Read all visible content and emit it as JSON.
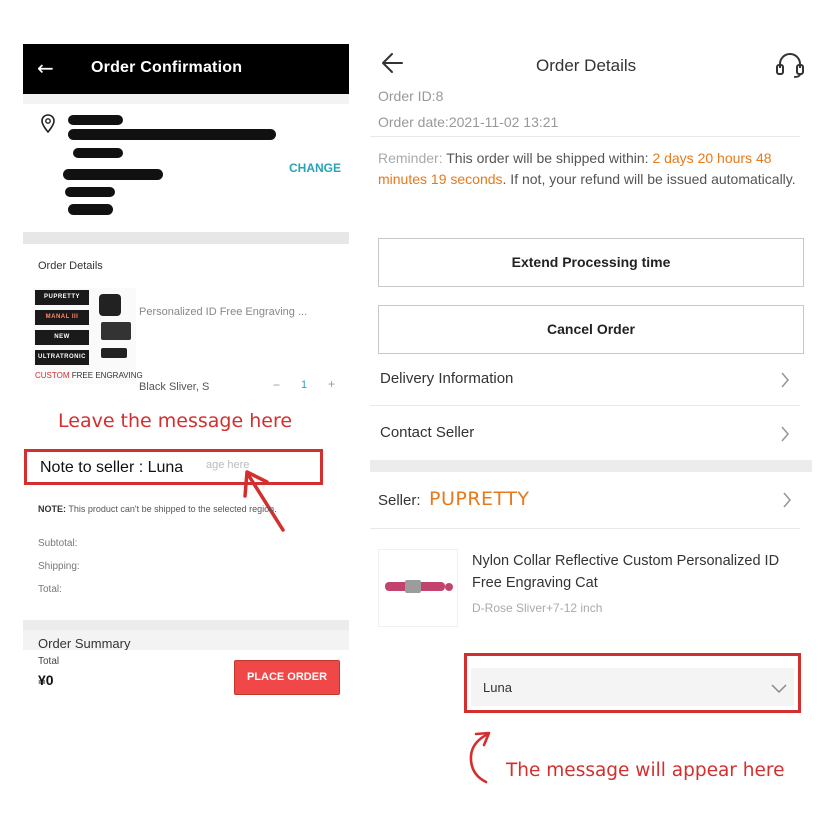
{
  "left_screen": {
    "header": {
      "back_icon": "arrow-left-icon",
      "title": "Order Confirmation"
    },
    "address": {
      "pin_icon": "location-pin-icon",
      "change_label": "CHANGE"
    },
    "order_details": {
      "section_title": "Order Details",
      "thumbnail_tags": [
        "PUPRETTY",
        "MANAL III",
        "NEW",
        "ULTRATRONIC"
      ],
      "thumbnail_caption_prefix": "CUSTOM",
      "thumbnail_caption_suffix": "FREE ENGRAVING",
      "product_name": "Personalized ID Free Engraving ...",
      "variant": "Black Sliver, S",
      "qty_minus": "−",
      "qty_value": "1",
      "qty_plus": "+"
    },
    "annotation_leave": "Leave the message here",
    "note_placeholder": "age here",
    "note_to_seller": "Note to seller :  Luna",
    "notice_bold": "NOTE:",
    "notice_text": "This product can't be shipped to the selected region.",
    "subtotal_label": "Subtotal:",
    "shipping_label": "Shipping:",
    "total_row_label": "Total:",
    "summary_title": "Order Summary",
    "footer": {
      "total_label": "Total",
      "total_value": "¥0",
      "place_order_label": "PLACE ORDER"
    },
    "accent_red": "#f04848",
    "accent_teal": "#2aa3b8"
  },
  "right_screen": {
    "header": {
      "back_icon": "arrow-left-icon",
      "title": "Order Details",
      "support_icon": "headset-icon"
    },
    "order_id": "Order ID:8",
    "order_date": "Order date:2021-11-02 13:21",
    "reminder": {
      "label": "Reminder:",
      "text_before": " This order will be shipped within: ",
      "countdown": "2 days 20 hours 48 minutes 19 seconds",
      "text_after": ". If not, your refund will be issued automatically."
    },
    "buttons": {
      "extend": "Extend Processing time",
      "cancel": "Cancel Order"
    },
    "rows": [
      {
        "label": "Delivery Information"
      },
      {
        "label": "Contact Seller"
      }
    ],
    "seller": {
      "label": "Seller:",
      "name": "PUPRETTY"
    },
    "product": {
      "name": "Nylon Collar Reflective Custom Personalized ID Free Engraving Cat",
      "variant": "D-Rose Sliver+7-12 inch"
    },
    "message_value": "Luna",
    "annotation_appear": "The message will appear here",
    "accent_orange": "#e8791a",
    "annotation_red": "#d32f2f"
  }
}
